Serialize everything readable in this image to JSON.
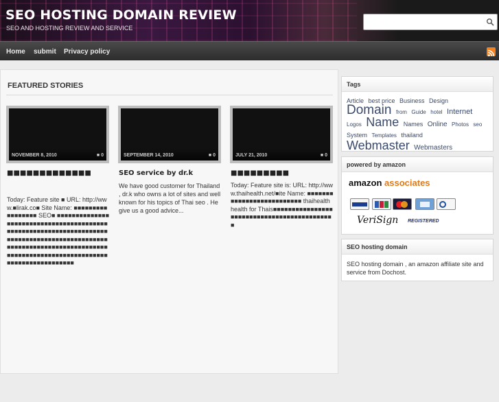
{
  "header": {
    "title": "SEO HOSTING DOMAIN REVIEW",
    "subtitle": "SEO AND HOSTING REVIEW AND SERVICE",
    "search_placeholder": ""
  },
  "nav": {
    "items": [
      "Home",
      "submit",
      "Privacy policy"
    ]
  },
  "featured": {
    "heading": "FEATURED STORIES",
    "cards": [
      {
        "date": "NOVEMBER 8, 2010",
        "comments": "0",
        "title": "■■■■■■■■■■■■■",
        "excerpt": "Today: Feature site ■ URL: http://www.■lirak.co■ Site Name: ■■■■■■■■■■■■■■■■■ SEO■ ■■■■■■■■■■■■■■■■■■■■■■■■■■■■■■■■■■■■■■■■■■■■■■■■■■■■■■■■■■■■■■■■■■■■■■■■■■■■■■■■■■■■■■■■■■■■■■■■■■■■■■■■■■■■■■■■■■■■■■■■■■■■■■■■■■■■■■■■■■■■■■■■■■■■■■■■■■■■■■■■■■■■■■■"
      },
      {
        "date": "SEPTEMBER 14, 2010",
        "comments": "0",
        "title": "SEO service by dr.k",
        "excerpt": "We have good customer for Thailand , dr.k who owns a lot of sites and well known for his topics of Thai seo . He give us a good advice..."
      },
      {
        "date": "JULY 21, 2010",
        "comments": "0",
        "title": "■■■■■■■■■",
        "excerpt": "Today: Feature site is: URL: http://www.thaihealth.net/■ite Name: ■■■■■■■■■■■■■■■■■■■■■■■■■■ thaihealth health for Thais■■■■■■■■■■■■■■■■■■■■■■■■■■■■■■■■■■■■■■■■■■■■"
      }
    ]
  },
  "sidebar": {
    "tags_title": "Tags",
    "tags": [
      {
        "label": "Article",
        "size": 9
      },
      {
        "label": "best price",
        "size": 9
      },
      {
        "label": "Business",
        "size": 9
      },
      {
        "label": "Design",
        "size": 9
      },
      {
        "label": "Domain",
        "size": 19
      },
      {
        "label": "from",
        "size": 8
      },
      {
        "label": "Guide",
        "size": 8
      },
      {
        "label": "hotel",
        "size": 8
      },
      {
        "label": "Internet",
        "size": 11
      },
      {
        "label": "Logos",
        "size": 8
      },
      {
        "label": "Name",
        "size": 18
      },
      {
        "label": "Names",
        "size": 9
      },
      {
        "label": "Online",
        "size": 10
      },
      {
        "label": "Photos",
        "size": 8
      },
      {
        "label": "seo",
        "size": 8
      },
      {
        "label": "System",
        "size": 9
      },
      {
        "label": "Templates",
        "size": 8
      },
      {
        "label": "thailand",
        "size": 9
      },
      {
        "label": "Webmaster",
        "size": 18
      },
      {
        "label": "Webmasters",
        "size": 10
      }
    ],
    "amazon_title": "powered by amazon",
    "amazon_logo_left": "amazon",
    "amazon_logo_right": "associates",
    "verisign": "VeriSign",
    "registered": "REGISTERED",
    "seo_title": "SEO hosting domain",
    "seo_text": "SEO hosting domain , an amazon affiliate site and service from Dochost."
  },
  "colors": {
    "accent_orange": "#e47911",
    "rss_orange": "#f58220",
    "link_blue": "#3a4a6b"
  },
  "icons": [
    "search-icon",
    "rss-icon",
    "comment-icon",
    "visa-card-icon",
    "jcb-card-icon",
    "mastercard-icon",
    "amex-card-icon",
    "diners-club-icon"
  ]
}
